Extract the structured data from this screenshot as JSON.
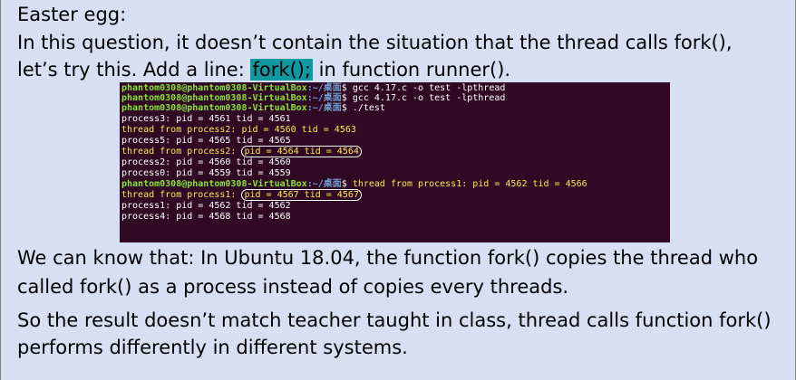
{
  "slide": {
    "line1": "Easter egg:",
    "line2": "In this question, it doesn’t contain the situation that the thread calls fork(),",
    "line3_pre": "let’s try this. Add a line: ",
    "line3_hl": "fork();",
    "line3_post": " in function runner().",
    "line4": "We can know that: In Ubuntu 18.04, the function fork() copies the thread who",
    "line5": "called fork() as a process instead of copies every threads.",
    "line6": "So the result doesn’t match teacher taught in class, thread calls function fork()",
    "line7": "performs differently in different systems.",
    "highlight_color": "#0e9aa0",
    "background_color": "#d6e0f2"
  },
  "terminal": {
    "prompt": "phantom0308@phantom0308-VirtualBox",
    "path": ":~/桌面",
    "dollar": "$ ",
    "cmd1": "gcc 4.17.c -o test -lpthread",
    "cmd2": "gcc 4.17.c -o test -lpthread",
    "cmd3": "./test",
    "out1": "process3: pid = 4561 tid = 4561",
    "out2": "thread from process2: pid = 4560 tid = 4563",
    "out3": "process5: pid = 4565 tid = 4565",
    "out4_pre": "thread from process2: ",
    "out4_circ": "pid = 4564 tid = 4564",
    "out5": "process2: pid = 4560 tid = 4560",
    "out6": "process0: pid = 4559 tid = 4559",
    "out7_tail": "thread from process1: pid = 4562 tid = 4566",
    "out8_pre": "thread from process1: ",
    "out8_circ": "pid = 4567 tid = 4567",
    "out9": "process1: pid = 4562 tid = 4562",
    "out10": "process4: pid = 4568 tid = 4568",
    "colors": {
      "background": "#300a24",
      "prompt": "#8ae234",
      "path": "#729fcf",
      "thread_output": "#fce94f",
      "output": "#ffffff"
    }
  }
}
